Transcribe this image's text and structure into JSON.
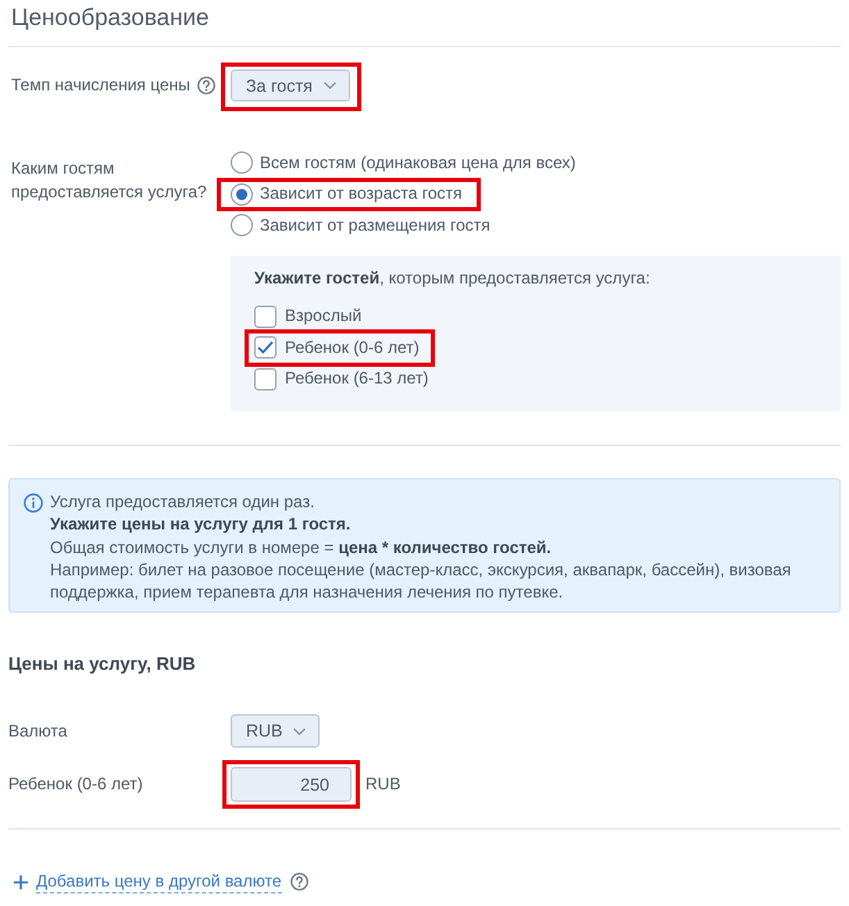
{
  "title": "Ценообразование",
  "rate": {
    "label": "Темп начисления цены",
    "value": "За гостя",
    "highlighted": true
  },
  "guests_question": {
    "label": "Каким гостям предоставляется услуга?",
    "options": [
      {
        "label": "Всем гостям (одинаковая цена для всех)",
        "selected": false,
        "highlighted": false
      },
      {
        "label": "Зависит от возраста гостя",
        "selected": true,
        "highlighted": true
      },
      {
        "label": "Зависит от размещения гостя",
        "selected": false,
        "highlighted": false
      }
    ]
  },
  "guest_panel": {
    "heading": "**Укажите гостей**, которым предоставляется услуга:",
    "guests": [
      {
        "label": "Взрослый",
        "checked": false,
        "highlighted": false
      },
      {
        "label": "Ребенок (0-6 лет)",
        "checked": true,
        "highlighted": true
      },
      {
        "label": "Ребенок (6-13 лет)",
        "checked": false,
        "highlighted": false
      }
    ]
  },
  "info": {
    "lines": [
      {
        "text": "Услуга предоставляется один раз.",
        "bold": false
      },
      {
        "text": "Укажите цены на услугу для 1 гостя.",
        "bold": true
      },
      {
        "text": "Общая стоимость услуги в номере = **цена * количество гостей.**",
        "bold": false
      },
      {
        "text": "Например: билет на разовое посещение (мастер-класс, экскурсия, аквапарк, бассейн), визовая поддержка, прием терапевта для назначения лечения по путевке.",
        "bold": false
      }
    ]
  },
  "prices": {
    "heading": "Цены на услугу, RUB",
    "currency": {
      "label": "Валюта",
      "value": "RUB"
    },
    "rows": [
      {
        "label": "Ребенок (0-6 лет)",
        "value": "250",
        "unit": "RUB",
        "highlighted": true
      }
    ]
  },
  "add_price": {
    "label": "Добавить цену в другой валюте"
  }
}
